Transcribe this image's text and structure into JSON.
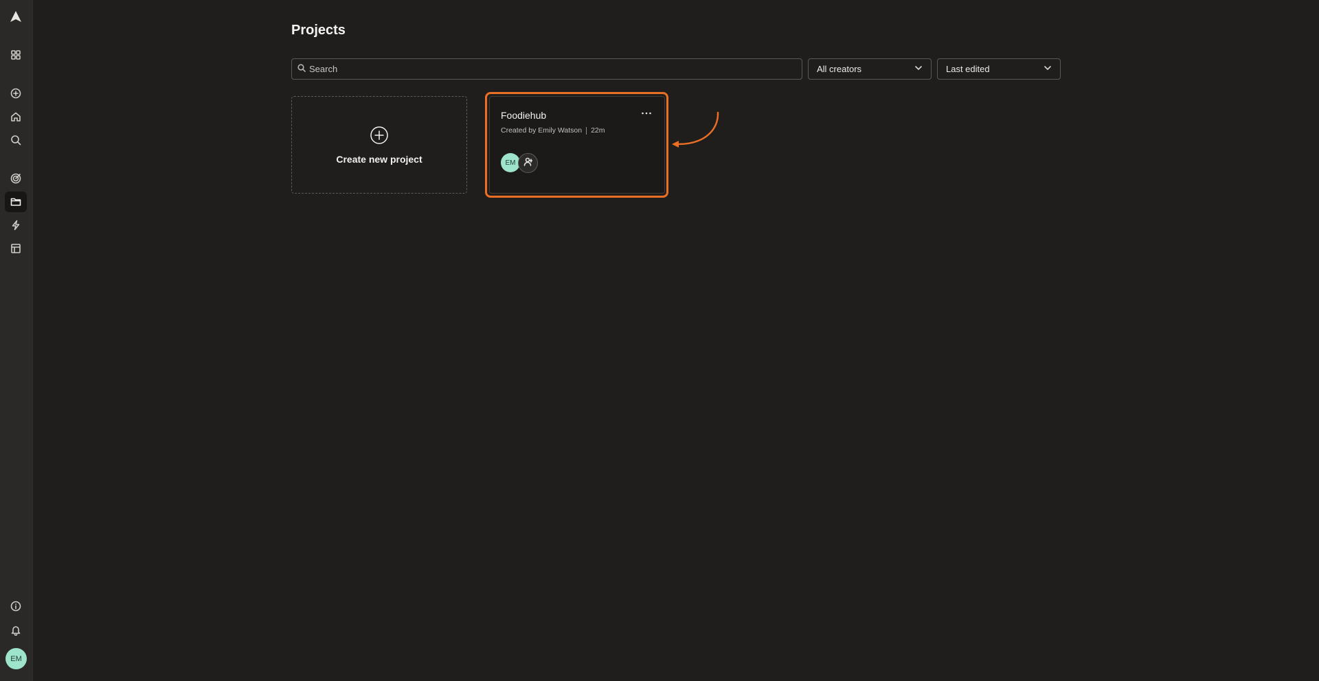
{
  "sidebar": {
    "logo_icon": "app-logo-icon",
    "items": [
      {
        "name": "apps",
        "icon": "grid-icon"
      },
      {
        "name": "new",
        "icon": "plus-circle-icon"
      },
      {
        "name": "home",
        "icon": "home-icon"
      },
      {
        "name": "search",
        "icon": "search-icon"
      },
      {
        "name": "goals",
        "icon": "target-icon"
      },
      {
        "name": "projects",
        "icon": "folder-icon",
        "active": true
      },
      {
        "name": "automations",
        "icon": "lightning-icon"
      },
      {
        "name": "templates",
        "icon": "layout-icon"
      },
      {
        "name": "info",
        "icon": "info-icon"
      },
      {
        "name": "notifications",
        "icon": "bell-icon"
      }
    ],
    "user_initials": "EM"
  },
  "page": {
    "title": "Projects"
  },
  "filters": {
    "search_placeholder": "Search",
    "creators_label": "All creators",
    "sort_label": "Last edited"
  },
  "create_card": {
    "label": "Create new project"
  },
  "projects": [
    {
      "name": "Foodiehub",
      "created_by": "Created by Emily Watson",
      "edited": "22m",
      "member_initials": "EM"
    }
  ],
  "colors": {
    "background": "#1f1e1d",
    "sidebar": "#2a2927",
    "highlight": "#ea6f24",
    "avatar": "#9ee3cb"
  }
}
